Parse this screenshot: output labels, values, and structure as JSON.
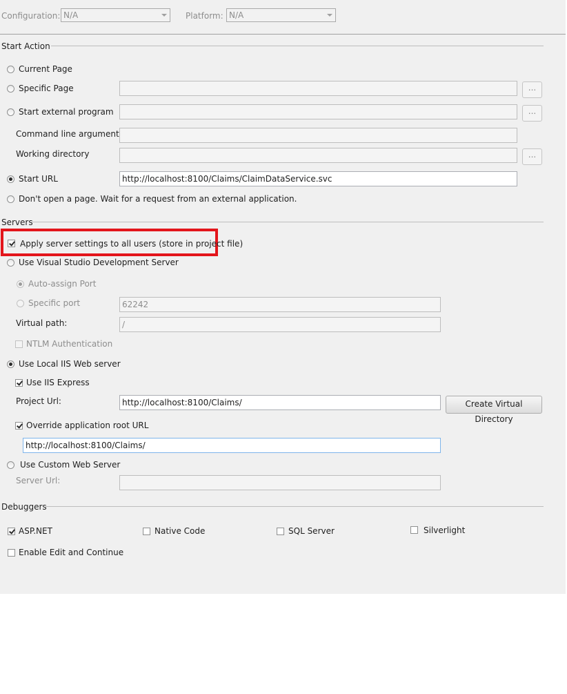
{
  "top": {
    "configuration_label": "Configuration:",
    "configuration_value": "N/A",
    "platform_label": "Platform:",
    "platform_value": "N/A"
  },
  "start_action": {
    "header": "Start Action",
    "current_page": "Current Page",
    "specific_page": "Specific Page",
    "specific_page_value": "",
    "start_external_program": "Start external program",
    "external_program_value": "",
    "command_line_arguments": "Command line arguments",
    "command_line_value": "",
    "working_directory": "Working directory",
    "working_directory_value": "",
    "browse_label": "...",
    "start_url": "Start URL",
    "start_url_value": "http://localhost:8100/Claims/ClaimDataService.svc",
    "dont_open": "Don't open a page.  Wait for a request from an external application.",
    "selected": "start_url"
  },
  "servers": {
    "header": "Servers",
    "apply_all_users": "Apply server settings to all users (store in project file)",
    "apply_all_users_checked": true,
    "use_vs_dev_server": "Use Visual Studio Development Server",
    "auto_assign_port": "Auto-assign Port",
    "specific_port": "Specific port",
    "specific_port_value": "62242",
    "virtual_path": "Virtual path:",
    "virtual_path_value": "/",
    "ntlm_auth": "NTLM Authentication",
    "use_local_iis": "Use Local IIS Web server",
    "use_iis_express": "Use IIS Express",
    "use_iis_express_checked": true,
    "project_url": "Project Url:",
    "project_url_value": "http://localhost:8100/Claims/",
    "create_virtual_directory": "Create Virtual Directory",
    "override_root_url": "Override application root URL",
    "override_root_url_checked": true,
    "override_root_url_value": "http://localhost:8100/Claims/",
    "use_custom_web_server": "Use Custom Web Server",
    "server_url": "Server Url:",
    "server_url_value": "",
    "selected": "use_local_iis"
  },
  "debuggers": {
    "header": "Debuggers",
    "aspnet": "ASP.NET",
    "aspnet_checked": true,
    "native_code": "Native Code",
    "native_code_checked": false,
    "sql_server": "SQL Server",
    "sql_server_checked": false,
    "silverlight": "Silverlight",
    "silverlight_checked": false,
    "enable_edit_continue": "Enable Edit and Continue",
    "enable_edit_continue_checked": false
  },
  "colors": {
    "panel_bg": "#f0f0f0",
    "highlight_box": "#e3151b",
    "focus_border": "#7eb4ea"
  }
}
